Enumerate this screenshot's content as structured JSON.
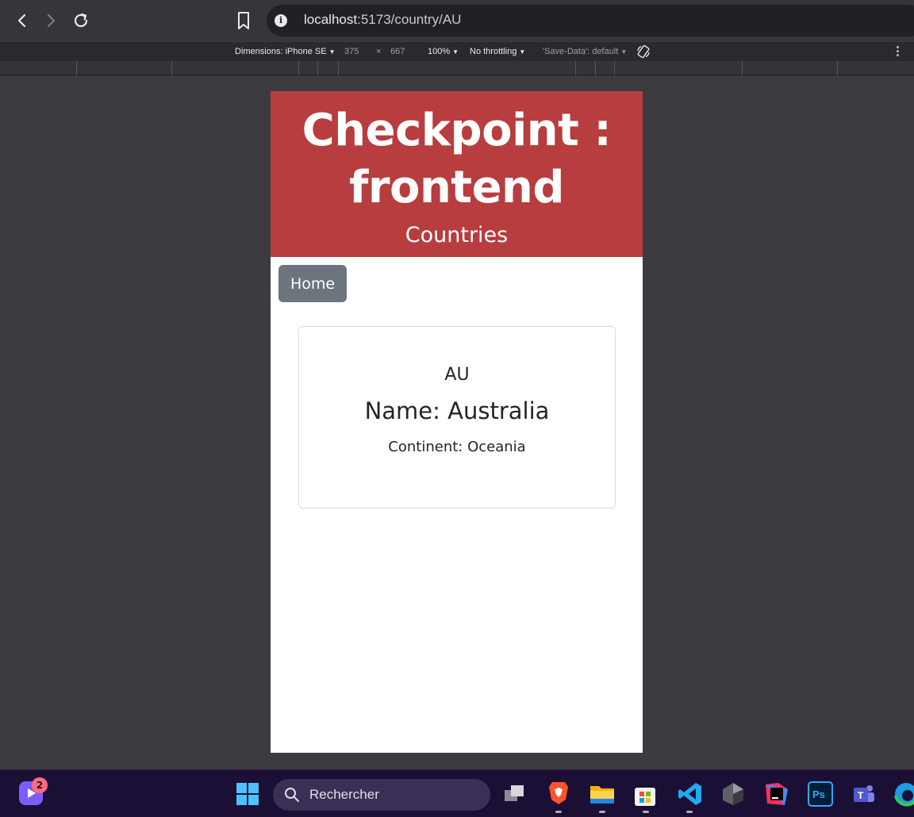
{
  "browser": {
    "url_host": "localhost",
    "url_path": ":5173/country/AU"
  },
  "devtools": {
    "device_label": "Dimensions: iPhone SE",
    "width": "375",
    "times": "×",
    "height": "667",
    "zoom": "100%",
    "throttling": "No throttling",
    "save_data": "'Save-Data': default"
  },
  "page": {
    "title": "Checkpoint : frontend",
    "subtitle": "Countries",
    "home_button": "Home",
    "country": {
      "code": "AU",
      "name": "Name: Australia",
      "continent": "Continent: Oceania"
    }
  },
  "taskbar": {
    "search_placeholder": "Rechercher",
    "notification_count": "2"
  }
}
